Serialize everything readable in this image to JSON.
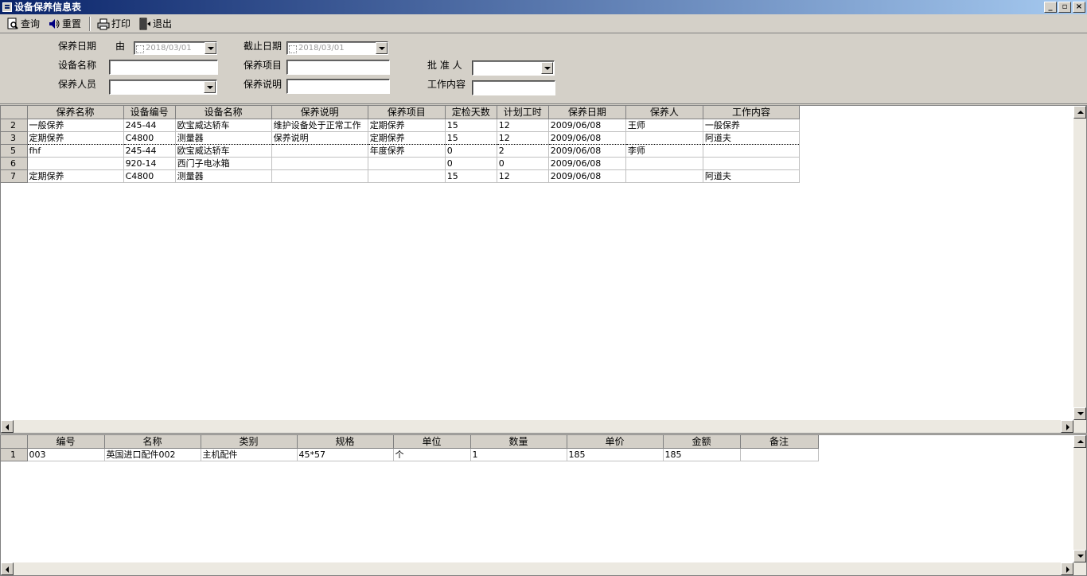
{
  "window": {
    "title": "设备保养信息表"
  },
  "toolbar": {
    "query": "查询",
    "reset": "重置",
    "print": "打印",
    "exit": "退出"
  },
  "form": {
    "maint_date_label": "保养日期",
    "from_label": "由",
    "from_date": "2018/03/01",
    "end_date_label": "截止日期",
    "end_date": "2018/03/01",
    "device_name_label": "设备名称",
    "device_name_value": "",
    "maint_item_label": "保养项目",
    "maint_item_value": "",
    "approver_label": "批 准 人",
    "approver_value": "",
    "maint_person_label": "保养人员",
    "maint_person_value": "",
    "maint_desc_label": "保养说明",
    "maint_desc_value": "",
    "work_content_label": "工作内容",
    "work_content_value": ""
  },
  "main_grid": {
    "columns": [
      "",
      "保养名称",
      "设备编号",
      "设备名称",
      "保养说明",
      "保养项目",
      "定检天数",
      "计划工时",
      "保养日期",
      "保养人",
      "工作内容"
    ],
    "rows": [
      [
        "2",
        "一般保养",
        "245-44",
        "欧宝威达轿车",
        "维护设备处于正常工作",
        "定期保养",
        "15",
        "12",
        "2009/06/08",
        "王师",
        "一般保养"
      ],
      [
        "3",
        "定期保养",
        "C4800",
        "测量器",
        "保养说明",
        "定期保养",
        "15",
        "12",
        "2009/06/08",
        "",
        "阿道夫"
      ],
      [
        "5",
        "fhf",
        "245-44",
        "欧宝威达轿车",
        "",
        "年度保养",
        "0",
        "2",
        "2009/06/08",
        "李师",
        ""
      ],
      [
        "6",
        "",
        "920-14",
        "西门子电冰箱",
        "",
        "",
        "0",
        "0",
        "2009/06/08",
        "",
        ""
      ],
      [
        "7",
        "定期保养",
        "C4800",
        "测量器",
        "",
        "",
        "15",
        "12",
        "2009/06/08",
        "",
        "阿道夫"
      ]
    ]
  },
  "parts_grid": {
    "columns": [
      "",
      "编号",
      "名称",
      "类别",
      "规格",
      "单位",
      "数量",
      "单价",
      "金额",
      "备注"
    ],
    "rows": [
      [
        "1",
        "003",
        "英国进口配件002",
        "主机配件",
        "45*57",
        "个",
        "1",
        "185",
        "185",
        ""
      ]
    ]
  }
}
